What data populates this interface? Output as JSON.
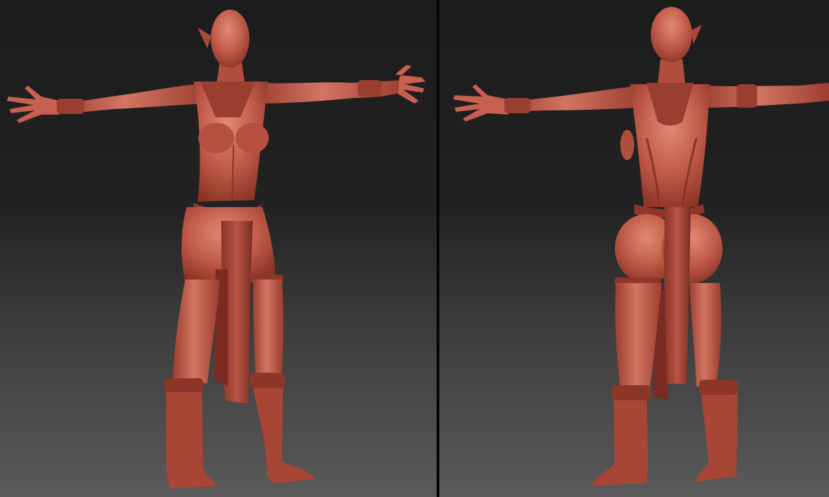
{
  "views": [
    {
      "id": "front",
      "label": ""
    },
    {
      "id": "back",
      "label": ""
    }
  ],
  "colors": {
    "sculpt_skin": "#c05a48",
    "sculpt_shadow": "#7e2e22",
    "sculpt_highlight": "#e5907c",
    "bg_top": "#1c1c1c",
    "bg_bottom": "#5a5a5a",
    "divider": "#050505"
  }
}
